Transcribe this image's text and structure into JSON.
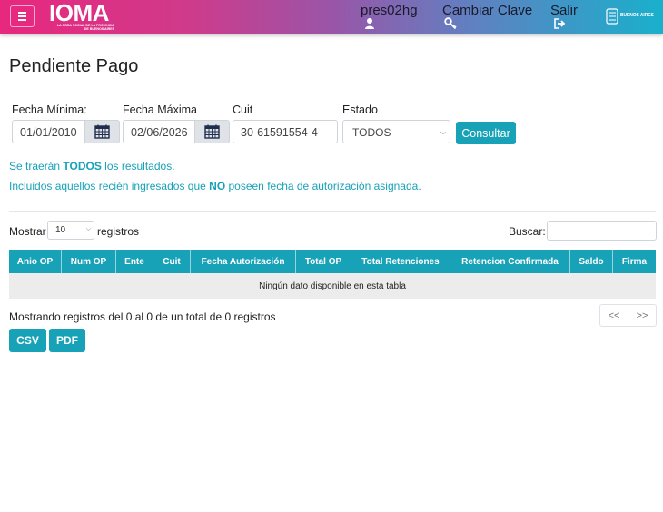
{
  "header": {
    "logo_text": "IOMA",
    "logo_subtitle_1": "LA OBRA SOCIAL DE LA PROVINCIA",
    "logo_subtitle_2": "DE BUENOS AIRES",
    "user_label": "pres02hg",
    "user_icon": "user-icon",
    "cambiar_clave_label": "Cambiar Clave",
    "key_icon": "key-icon",
    "salir_label": "Salir",
    "salir_icon": "sign-out-icon",
    "province_logo_text": "BUENOS AIRES",
    "accent_color": "#e8277f"
  },
  "page": {
    "title": "Pendiente Pago"
  },
  "filters": {
    "fecha_minima_label": "Fecha Mínima:",
    "fecha_minima_value": "01/01/2010",
    "fecha_maxima_label": "Fecha Máxima",
    "fecha_maxima_value": "02/06/2026",
    "cuit_label": "Cuit",
    "cuit_value": "30-61591554-4",
    "estado_label": "Estado",
    "estado_value": "TODOS",
    "consultar_label": "Consultar",
    "calendar_icon": "calendar-icon"
  },
  "info": {
    "line1_prefix": "Se traerán ",
    "line1_bold": "TODOS",
    "line1_suffix": " los resultados.",
    "line2_prefix": "Incluidos aquellos recién ingresados que ",
    "line2_bold": "NO",
    "line2_suffix": " poseen fecha de autorización asignada.",
    "color": "#17a2b8"
  },
  "table_controls": {
    "mostrar_label": "Mostrar",
    "page_length_value": "10",
    "registros_label": "registros",
    "buscar_label": "Buscar:",
    "buscar_value": ""
  },
  "table": {
    "columns": [
      "Anio OP",
      "Num OP",
      "Ente",
      "Cuit",
      "Fecha Autorización",
      "Total OP",
      "Total Retenciones",
      "Retencion Confirmada",
      "Saldo",
      "Firma"
    ],
    "empty_message": "Ningún dato disponible en esta tabla",
    "header_color": "#17a2b8"
  },
  "footer": {
    "info_text": "Mostrando registros del 0 al 0 de un total de 0 registros",
    "prev_label": "<<",
    "next_label": ">>",
    "csv_label": "CSV",
    "pdf_label": "PDF"
  }
}
